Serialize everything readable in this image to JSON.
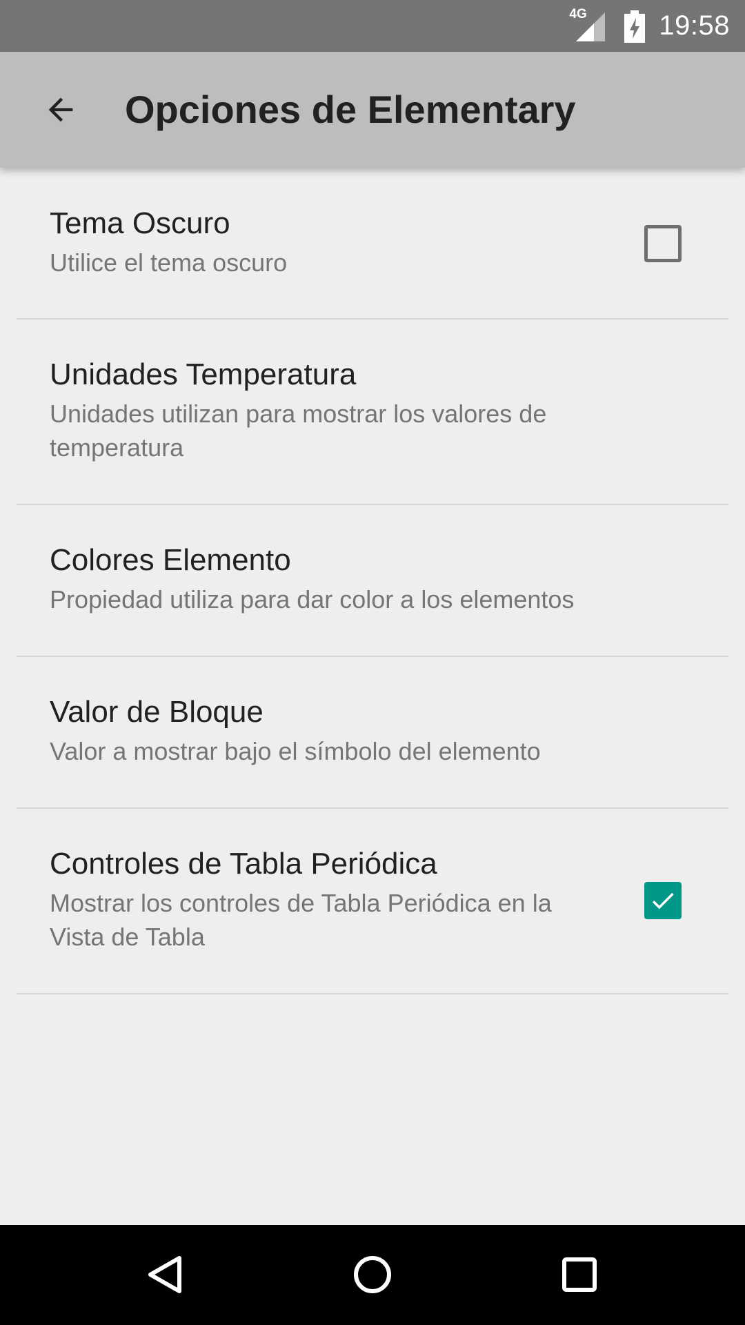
{
  "status_bar": {
    "network": "4G",
    "time": "19:58",
    "icons": [
      "signal-icon",
      "battery-icon"
    ]
  },
  "app_bar": {
    "back_icon": "arrow-back-icon",
    "title": "Opciones de Elementary"
  },
  "preferences": [
    {
      "title": "Tema Oscuro",
      "summary": "Utilice el tema oscuro",
      "checkbox": "unchecked"
    },
    {
      "title": "Unidades Temperatura",
      "summary": "Unidades utilizan para mostrar los valores de temperatura"
    },
    {
      "title": "Colores Elemento",
      "summary": "Propiedad utiliza para dar color a los elementos"
    },
    {
      "title": "Valor de Bloque",
      "summary": "Valor a mostrar bajo el símbolo del elemento"
    },
    {
      "title": "Controles de Tabla Periódica",
      "summary": "Mostrar los controles de Tabla Periódica en la Vista de Tabla",
      "checkbox": "checked"
    }
  ],
  "colors": {
    "accent": "#009688",
    "app_bar": "#bdbdbd",
    "status_bar": "#757575"
  },
  "nav_bar": {
    "icons": [
      "back-triangle-icon",
      "home-circle-icon",
      "recents-square-icon"
    ]
  }
}
